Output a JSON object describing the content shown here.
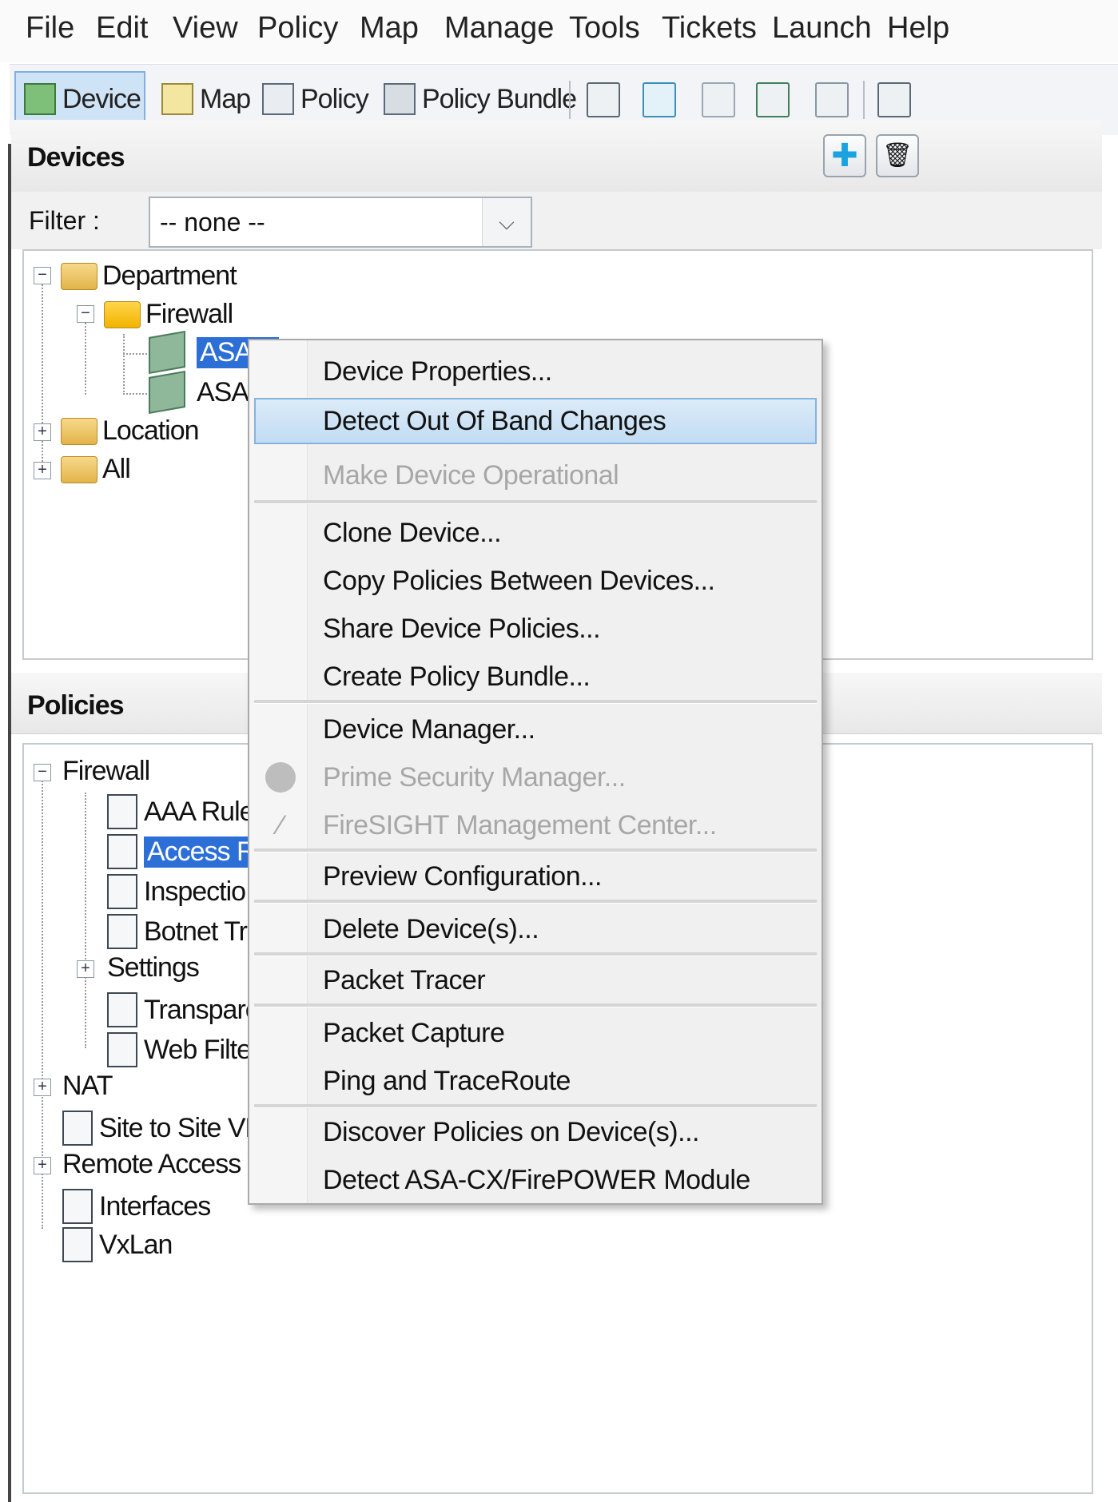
{
  "menubar": {
    "items": [
      "File",
      "Edit",
      "View",
      "Policy",
      "Map",
      "Manage",
      "Tools",
      "Tickets",
      "Launch",
      "Help"
    ]
  },
  "toolbar": {
    "buttons": [
      {
        "label": "Device",
        "icon": "device-icon",
        "active": true
      },
      {
        "label": "Map",
        "icon": "map-icon",
        "active": false
      },
      {
        "label": "Policy",
        "icon": "policy-icon",
        "active": false
      },
      {
        "label": "Policy Bundle",
        "icon": "policy-bundle-icon",
        "active": false
      }
    ]
  },
  "devices_panel": {
    "title": "Devices",
    "add_icon": "plus-icon",
    "delete_icon": "trash-icon",
    "filter_label": "Filter :",
    "filter_value": "-- none --",
    "tree": {
      "department": "Department",
      "firewall": "Firewall",
      "asa_1": "ASA",
      "asa_2": "ASA",
      "location": "Location",
      "all": "All"
    }
  },
  "policies_panel": {
    "title": "Policies",
    "tree": {
      "firewall": "Firewall",
      "aaa_rules": "AAA Rule",
      "access_rules": "Access Ru",
      "inspection": "Inspectio",
      "botnet": "Botnet Tr",
      "settings": "Settings",
      "transparent": "Transpare",
      "web_filter": "Web Filte",
      "nat": "NAT",
      "site_to_site": "Site to Site VP",
      "remote_access": "Remote Access VP",
      "interfaces": "Interfaces",
      "vxlan": "VxLan"
    }
  },
  "context_menu": {
    "device_properties": "Device Properties...",
    "detect_oob": "Detect Out Of Band Changes",
    "make_operational": "Make Device Operational",
    "clone_device": "Clone Device...",
    "copy_policies": "Copy Policies Between Devices...",
    "share_policies": "Share Device Policies...",
    "create_bundle": "Create Policy Bundle...",
    "device_manager": "Device Manager...",
    "prime_security": "Prime Security Manager...",
    "firesight": "FireSIGHT Management Center...",
    "preview_config": "Preview Configuration...",
    "delete_devices": "Delete Device(s)...",
    "packet_tracer": "Packet Tracer",
    "packet_capture": "Packet Capture",
    "ping_traceroute": "Ping and TraceRoute",
    "discover_policies": "Discover Policies on Device(s)...",
    "detect_module": "Detect ASA-CX/FirePOWER Module"
  }
}
